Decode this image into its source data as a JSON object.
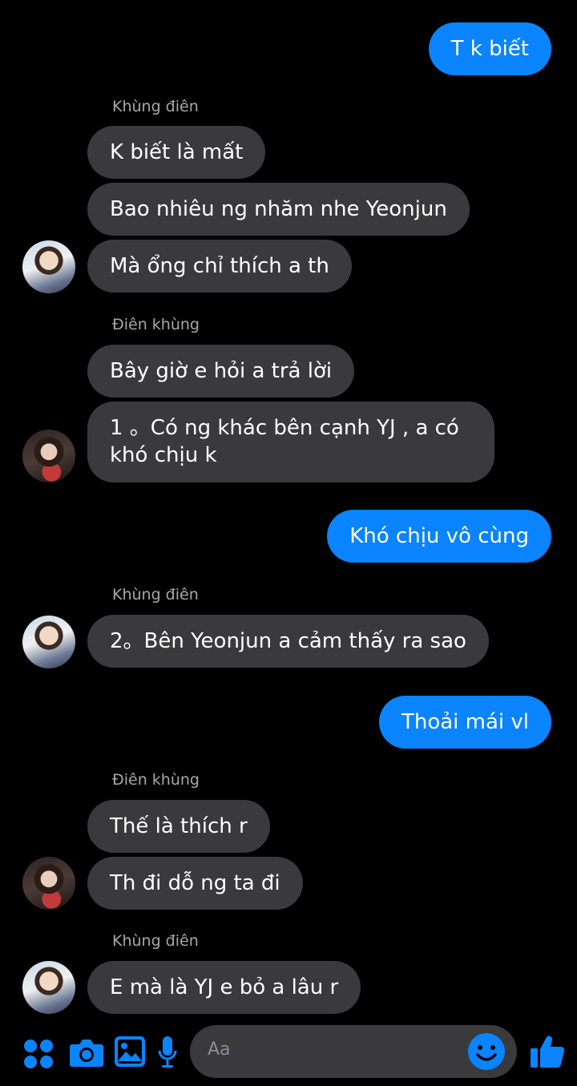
{
  "messages": [
    {
      "text": "T k biết"
    },
    {
      "text": "Khùng điên"
    },
    {
      "text": "K biết là mất"
    },
    {
      "text": "Bao nhiêu ng nhăm nhe Yeonjun"
    },
    {
      "text": "Mà ổng chỉ thích a th"
    },
    {
      "text": "Điên khùng"
    },
    {
      "text": "Bây giờ e hỏi a trả lời"
    },
    {
      "text": "1 。Có ng khác bên cạnh YJ , a có khó chịu k"
    },
    {
      "text": "Khó chịu vô cùng"
    },
    {
      "text": "Khùng điên"
    },
    {
      "text": "2。Bên Yeonjun a cảm thấy ra sao"
    },
    {
      "text": "Thoải mái vl"
    },
    {
      "text": "Điên khùng"
    },
    {
      "text": "Thế là thích r"
    },
    {
      "text": "Th đi dỗ ng ta đi"
    },
    {
      "text": "Khùng điên"
    },
    {
      "text": "E mà là YJ e bỏ a lâu r"
    }
  ],
  "composer": {
    "placeholder": "Aa",
    "accent_color": "#0a84ff"
  },
  "colors": {
    "sent_bubble": "#0a84ff",
    "received_bubble": "#3a3a3c",
    "background": "#000000"
  }
}
